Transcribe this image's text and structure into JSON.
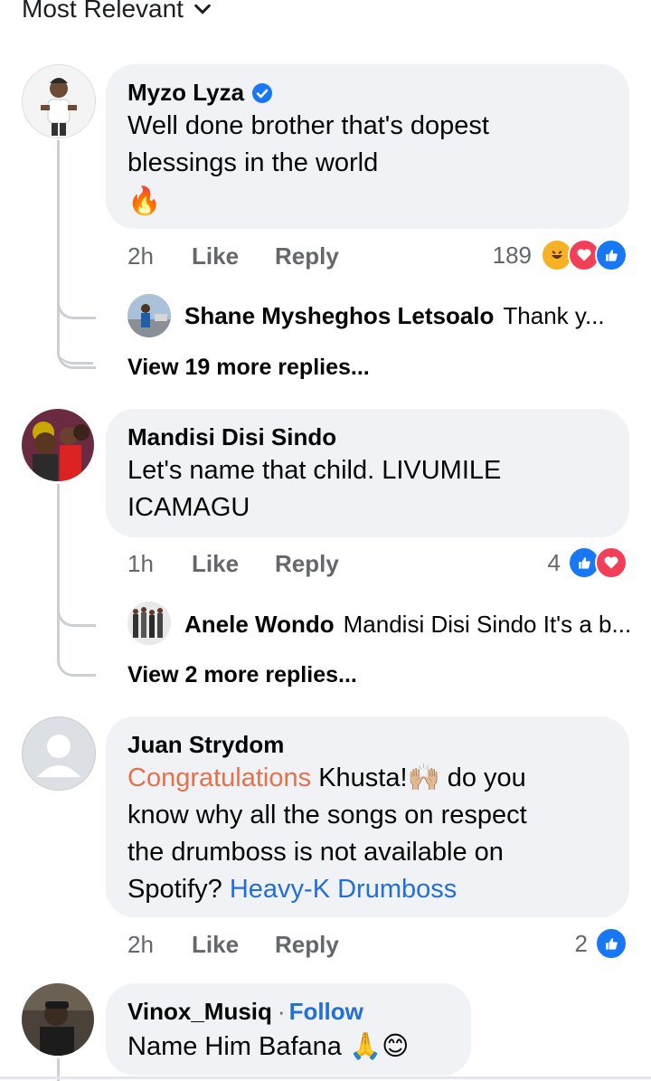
{
  "sort": {
    "label": "Most Relevant"
  },
  "comments": [
    {
      "author": "Myzo Lyza",
      "verified": true,
      "text_line1": "Well done brother that's dopest",
      "text_line2": "blessings in the world",
      "emoji": "🔥",
      "time": "2h",
      "like": "Like",
      "reply": "Reply",
      "reaction_count": "189",
      "reply_preview": {
        "name": "Shane Mysheghos Letsoalo",
        "text": "Thank y..."
      },
      "view_more": "View 19 more replies..."
    },
    {
      "author": "Mandisi Disi Sindo",
      "text_line1": "Let's name that child. LIVUMILE",
      "text_line2": "ICAMAGU",
      "time": "1h",
      "like": "Like",
      "reply": "Reply",
      "reaction_count": "4",
      "reply_preview": {
        "name": "Anele Wondo",
        "text": "Mandisi Disi Sindo It's a b..."
      },
      "view_more": "View 2 more replies..."
    },
    {
      "author": "Juan Strydom",
      "text_tag": "Congratulations",
      "text_rest1": " Khusta!🙌🏼 do you",
      "text_line2": "know why all the songs on respect",
      "text_line3": "the drumboss is not available on",
      "text_line4": "Spotify?",
      "mention": "Heavy-K Drumboss",
      "time": "2h",
      "like": "Like",
      "reply": "Reply",
      "reaction_count": "2"
    },
    {
      "author": "Vinox_Musiq",
      "separator": "·",
      "follow": "Follow",
      "text": "Name Him Bafana",
      "emojis": "🙏😊"
    }
  ],
  "colors": {
    "like_blue": "#1877f2",
    "love_red": "#f33e58",
    "haha_yellow": "#f7b125",
    "tag_orange": "#e4714a",
    "link_blue": "#216fdb"
  },
  "icons": [
    "chevron-down-icon",
    "verified-badge-icon",
    "like-reaction-icon",
    "love-reaction-icon",
    "haha-reaction-icon",
    "default-avatar-icon"
  ]
}
